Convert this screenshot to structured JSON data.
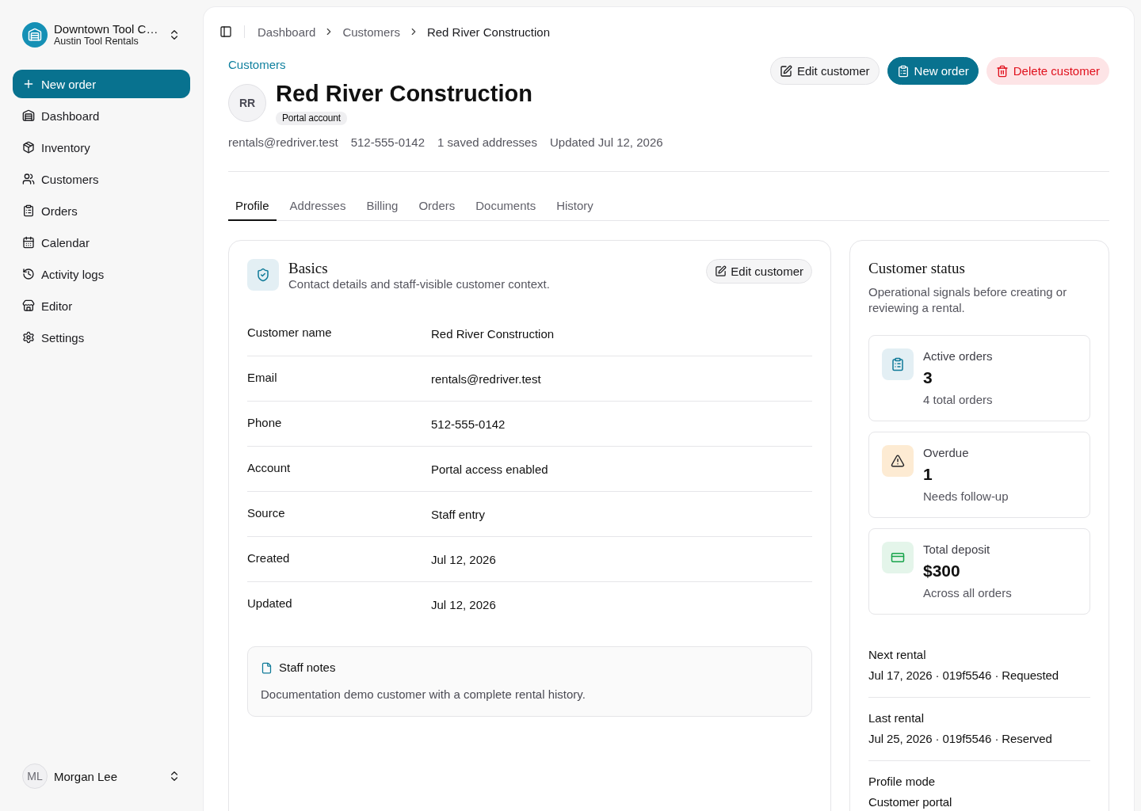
{
  "sidebar": {
    "org": {
      "name": "Downtown Tool C…",
      "subtitle": "Austin Tool Rentals"
    },
    "new_order": "New order",
    "nav": [
      {
        "label": "Dashboard",
        "selected": false
      },
      {
        "label": "Inventory",
        "selected": false
      },
      {
        "label": "Customers",
        "selected": false
      },
      {
        "label": "Orders",
        "selected": false
      },
      {
        "label": "Calendar",
        "selected": false
      },
      {
        "label": "Activity logs",
        "selected": false
      },
      {
        "label": "Editor",
        "selected": false
      },
      {
        "label": "Settings",
        "selected": false
      }
    ],
    "user": {
      "initials": "ML",
      "name": "Morgan Lee"
    }
  },
  "breadcrumb": [
    "Dashboard",
    "Customers",
    "Red River Construction"
  ],
  "header": {
    "back_link": "Customers",
    "initials": "RR",
    "title": "Red River Construction",
    "badge": "Portal account",
    "meta": [
      "rentals@redriver.test",
      "512-555-0142",
      "1 saved addresses",
      "Updated Jul 12, 2026"
    ],
    "actions": [
      {
        "label": "Edit customer",
        "kind": "secondary"
      },
      {
        "label": "New order",
        "kind": "primary"
      },
      {
        "label": "Delete customer",
        "kind": "danger"
      }
    ]
  },
  "tabs": [
    {
      "label": "Profile",
      "selected": true
    },
    {
      "label": "Addresses",
      "selected": false
    },
    {
      "label": "Billing",
      "selected": false
    },
    {
      "label": "Orders",
      "selected": false
    },
    {
      "label": "Documents",
      "selected": false
    },
    {
      "label": "History",
      "selected": false
    }
  ],
  "basics": {
    "title": "Basics",
    "subtitle": "Contact details and staff-visible customer context.",
    "edit_button": "Edit customer",
    "fields": [
      {
        "label": "Customer name",
        "value": "Red River Construction"
      },
      {
        "label": "Email",
        "value": "rentals@redriver.test"
      },
      {
        "label": "Phone",
        "value": "512-555-0142"
      },
      {
        "label": "Account",
        "value": "Portal access enabled"
      },
      {
        "label": "Source",
        "value": "Staff entry"
      },
      {
        "label": "Created",
        "value": "Jul 12, 2026"
      },
      {
        "label": "Updated",
        "value": "Jul 12, 2026"
      }
    ],
    "notes": {
      "title": "Staff notes",
      "text": "Documentation demo customer with a complete rental history."
    }
  },
  "status": {
    "title": "Customer status",
    "description": "Operational signals before creating or reviewing a rental.",
    "stats": [
      {
        "kind": "orders",
        "label": "Active orders",
        "value": "3",
        "note": "4 total orders"
      },
      {
        "kind": "overdue",
        "label": "Overdue",
        "value": "1",
        "note": "Needs follow-up"
      },
      {
        "kind": "deposit",
        "label": "Total deposit",
        "value": "$300",
        "note": "Across all orders"
      }
    ],
    "details": [
      {
        "label": "Next rental",
        "value": "Jul 17, 2026 · 019f5546 · Requested"
      },
      {
        "label": "Last rental",
        "value": "Jul 25, 2026 · 019f5546 · Reserved"
      },
      {
        "label": "Profile mode",
        "value": "Customer portal"
      }
    ]
  }
}
